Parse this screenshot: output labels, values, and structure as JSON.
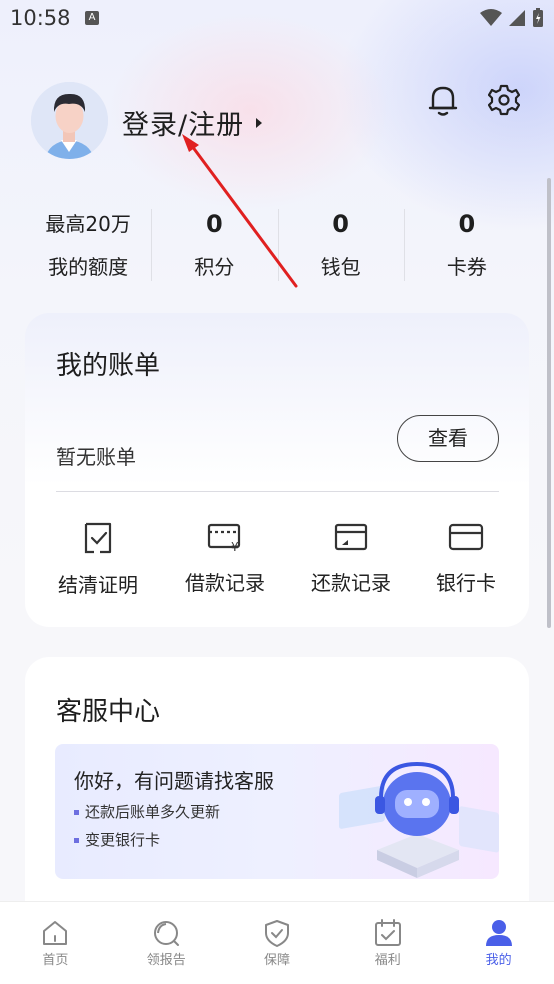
{
  "status_bar": {
    "time": "10:58",
    "notification_letter": "A"
  },
  "profile": {
    "login_label": "登录/注册"
  },
  "stats": [
    {
      "value": "最高20万",
      "label": "我的额度"
    },
    {
      "value": "0",
      "label": "积分"
    },
    {
      "value": "0",
      "label": "钱包"
    },
    {
      "value": "0",
      "label": "卡券"
    }
  ],
  "bill": {
    "title": "我的账单",
    "empty_text": "暂无账单",
    "view_button": "查看",
    "actions": [
      {
        "label": "结清证明",
        "icon": "certificate-icon"
      },
      {
        "label": "借款记录",
        "icon": "loan-record-icon"
      },
      {
        "label": "还款记录",
        "icon": "repayment-record-icon"
      },
      {
        "label": "银行卡",
        "icon": "bank-card-icon"
      }
    ]
  },
  "service": {
    "title": "客服中心",
    "banner_title": "你好，有问题请找客服",
    "faq": [
      "还款后账单多久更新",
      "变更银行卡"
    ]
  },
  "tabbar": {
    "tabs": [
      {
        "label": "首页",
        "icon": "home-icon"
      },
      {
        "label": "领报告",
        "icon": "report-icon"
      },
      {
        "label": "保障",
        "icon": "shield-icon"
      },
      {
        "label": "福利",
        "icon": "calendar-icon"
      },
      {
        "label": "我的",
        "icon": "user-icon"
      }
    ],
    "active": "我的"
  },
  "colors": {
    "accent": "#4a5fe8",
    "annotation_arrow": "#e02020"
  }
}
